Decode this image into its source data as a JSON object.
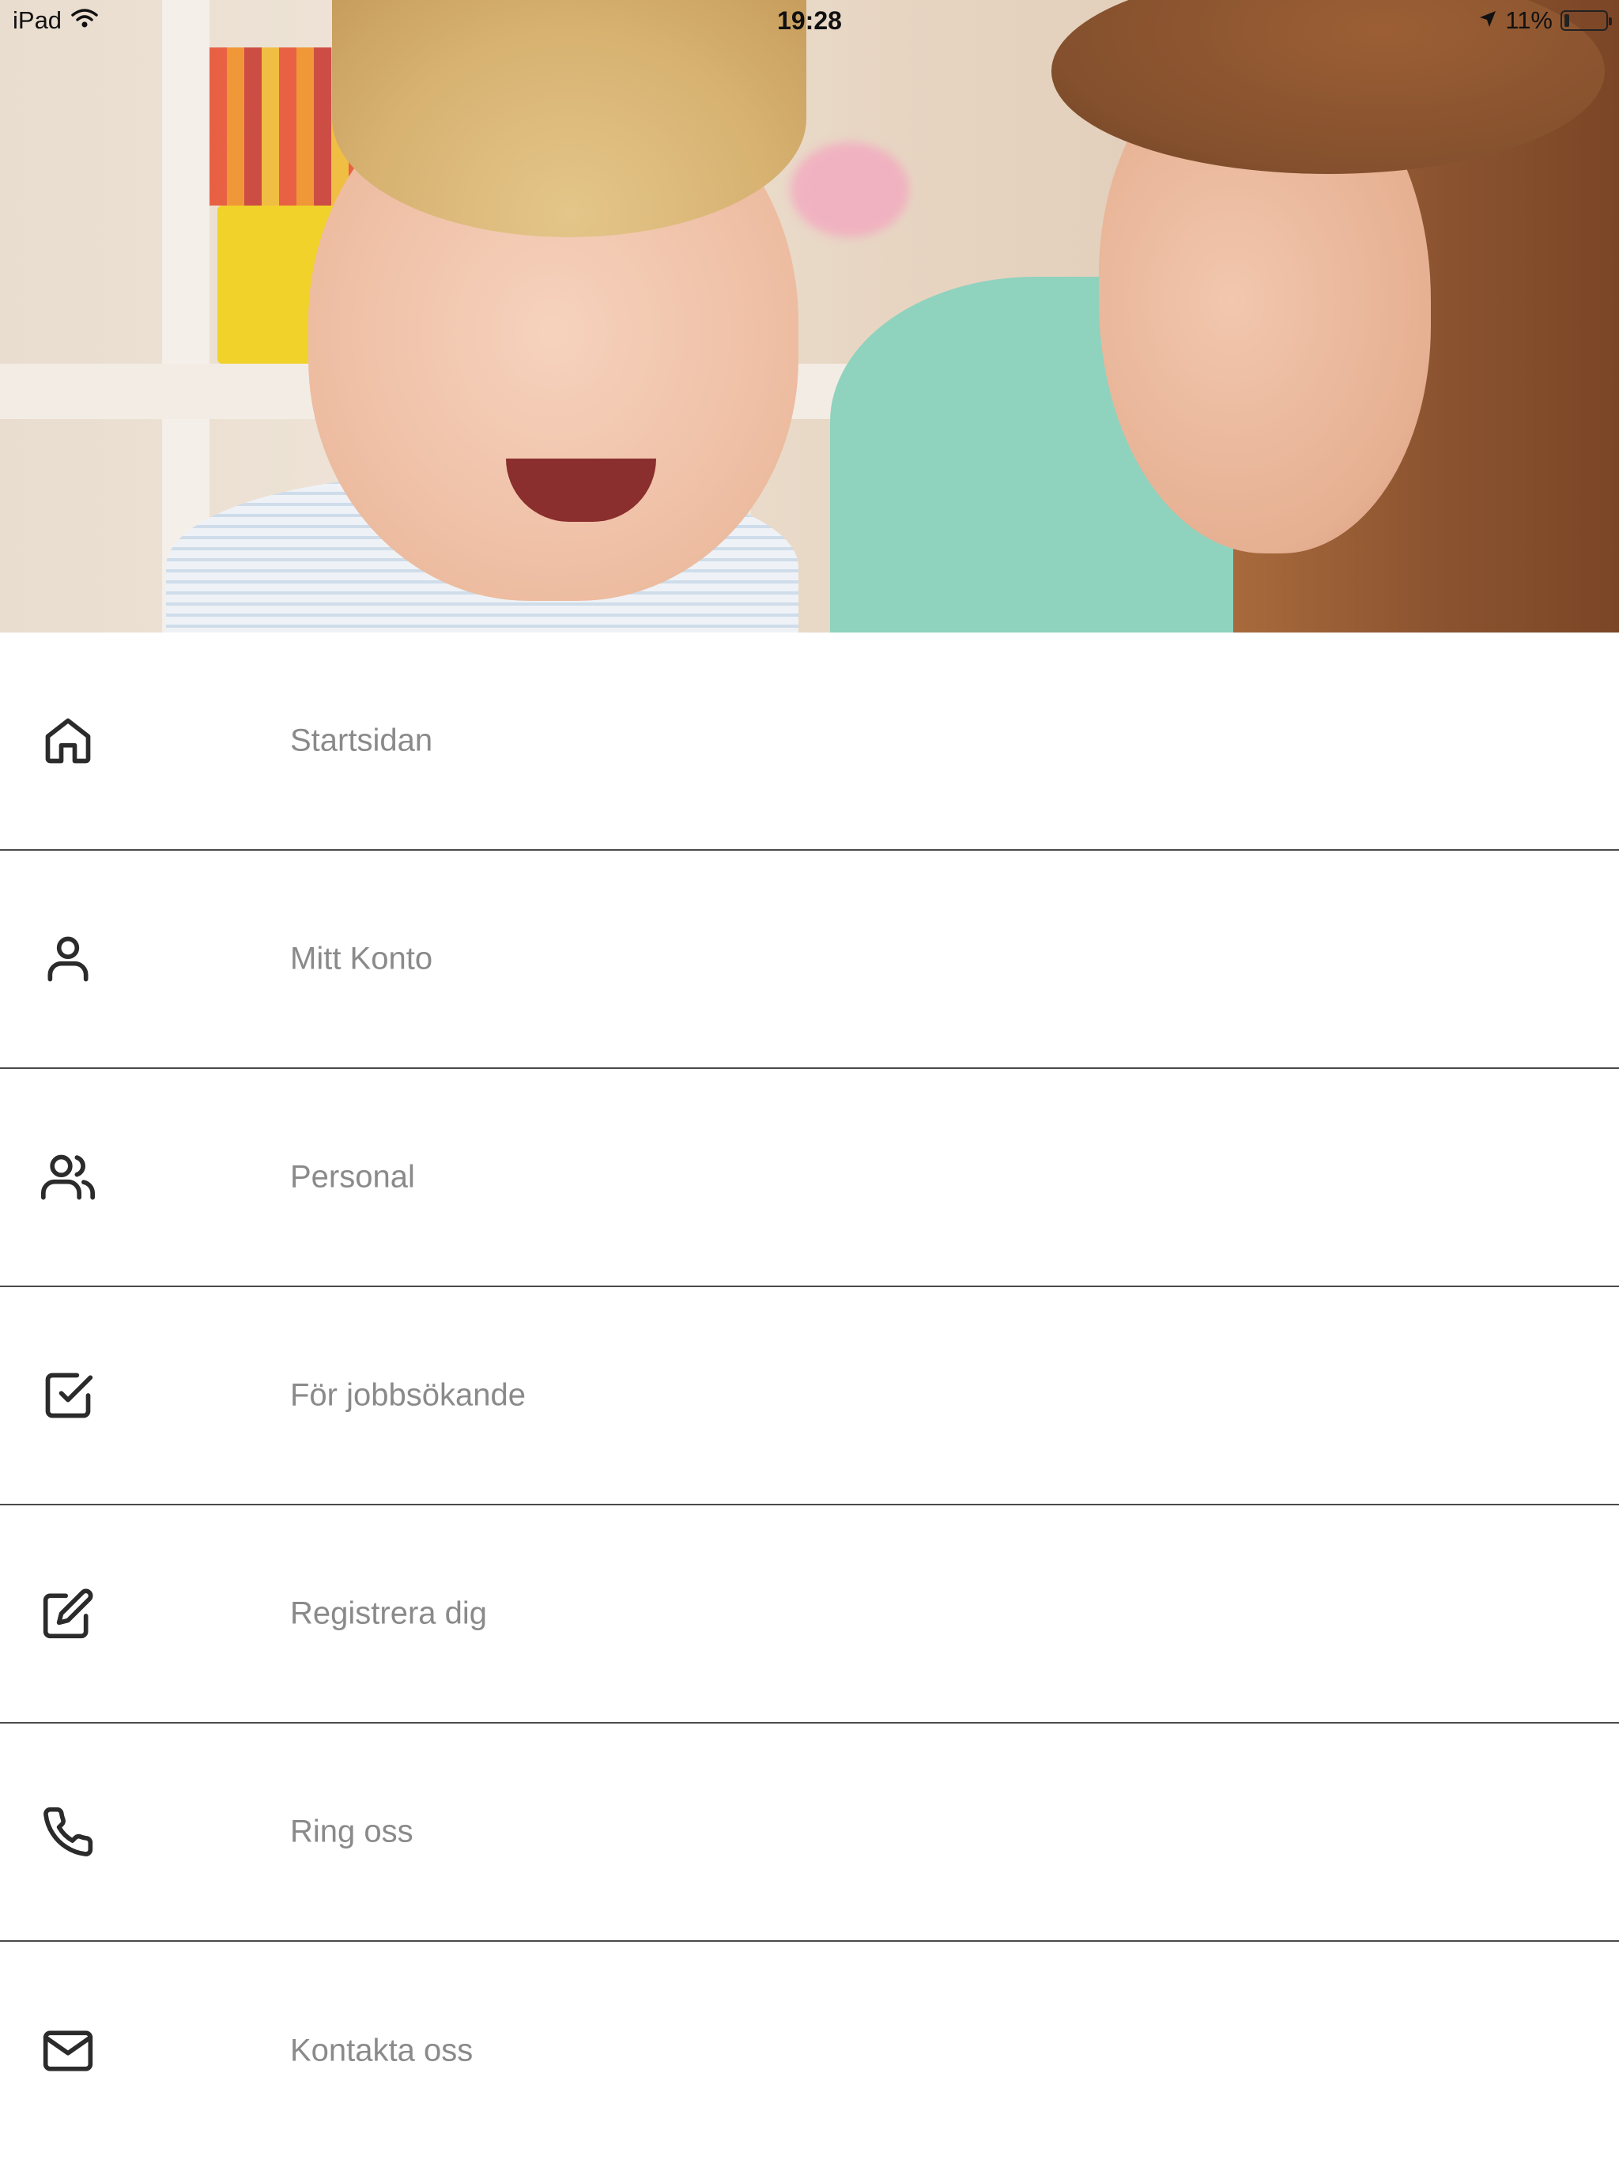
{
  "status_bar": {
    "device": "iPad",
    "time": "19:28",
    "battery_percent": "11%",
    "battery_level": 0.11,
    "icons": [
      "wifi-icon",
      "location-arrow-icon",
      "battery-icon"
    ]
  },
  "hero": {
    "image_subject": "smiling child and woman in playroom"
  },
  "menu": {
    "items": [
      {
        "label": "Startsidan",
        "icon": "home-icon"
      },
      {
        "label": "Mitt Konto",
        "icon": "user-icon"
      },
      {
        "label": "Personal",
        "icon": "users-icon"
      },
      {
        "label": "För jobbsökande",
        "icon": "check-square-icon"
      },
      {
        "label": "Registrera dig",
        "icon": "edit-icon"
      },
      {
        "label": "Ring oss",
        "icon": "phone-icon"
      },
      {
        "label": "Kontakta oss",
        "icon": "mail-icon"
      }
    ]
  },
  "colors": {
    "label_text": "#8a8a8a",
    "icon_stroke": "#2b2b2b",
    "divider": "#4a4a4a",
    "background": "#ffffff"
  }
}
